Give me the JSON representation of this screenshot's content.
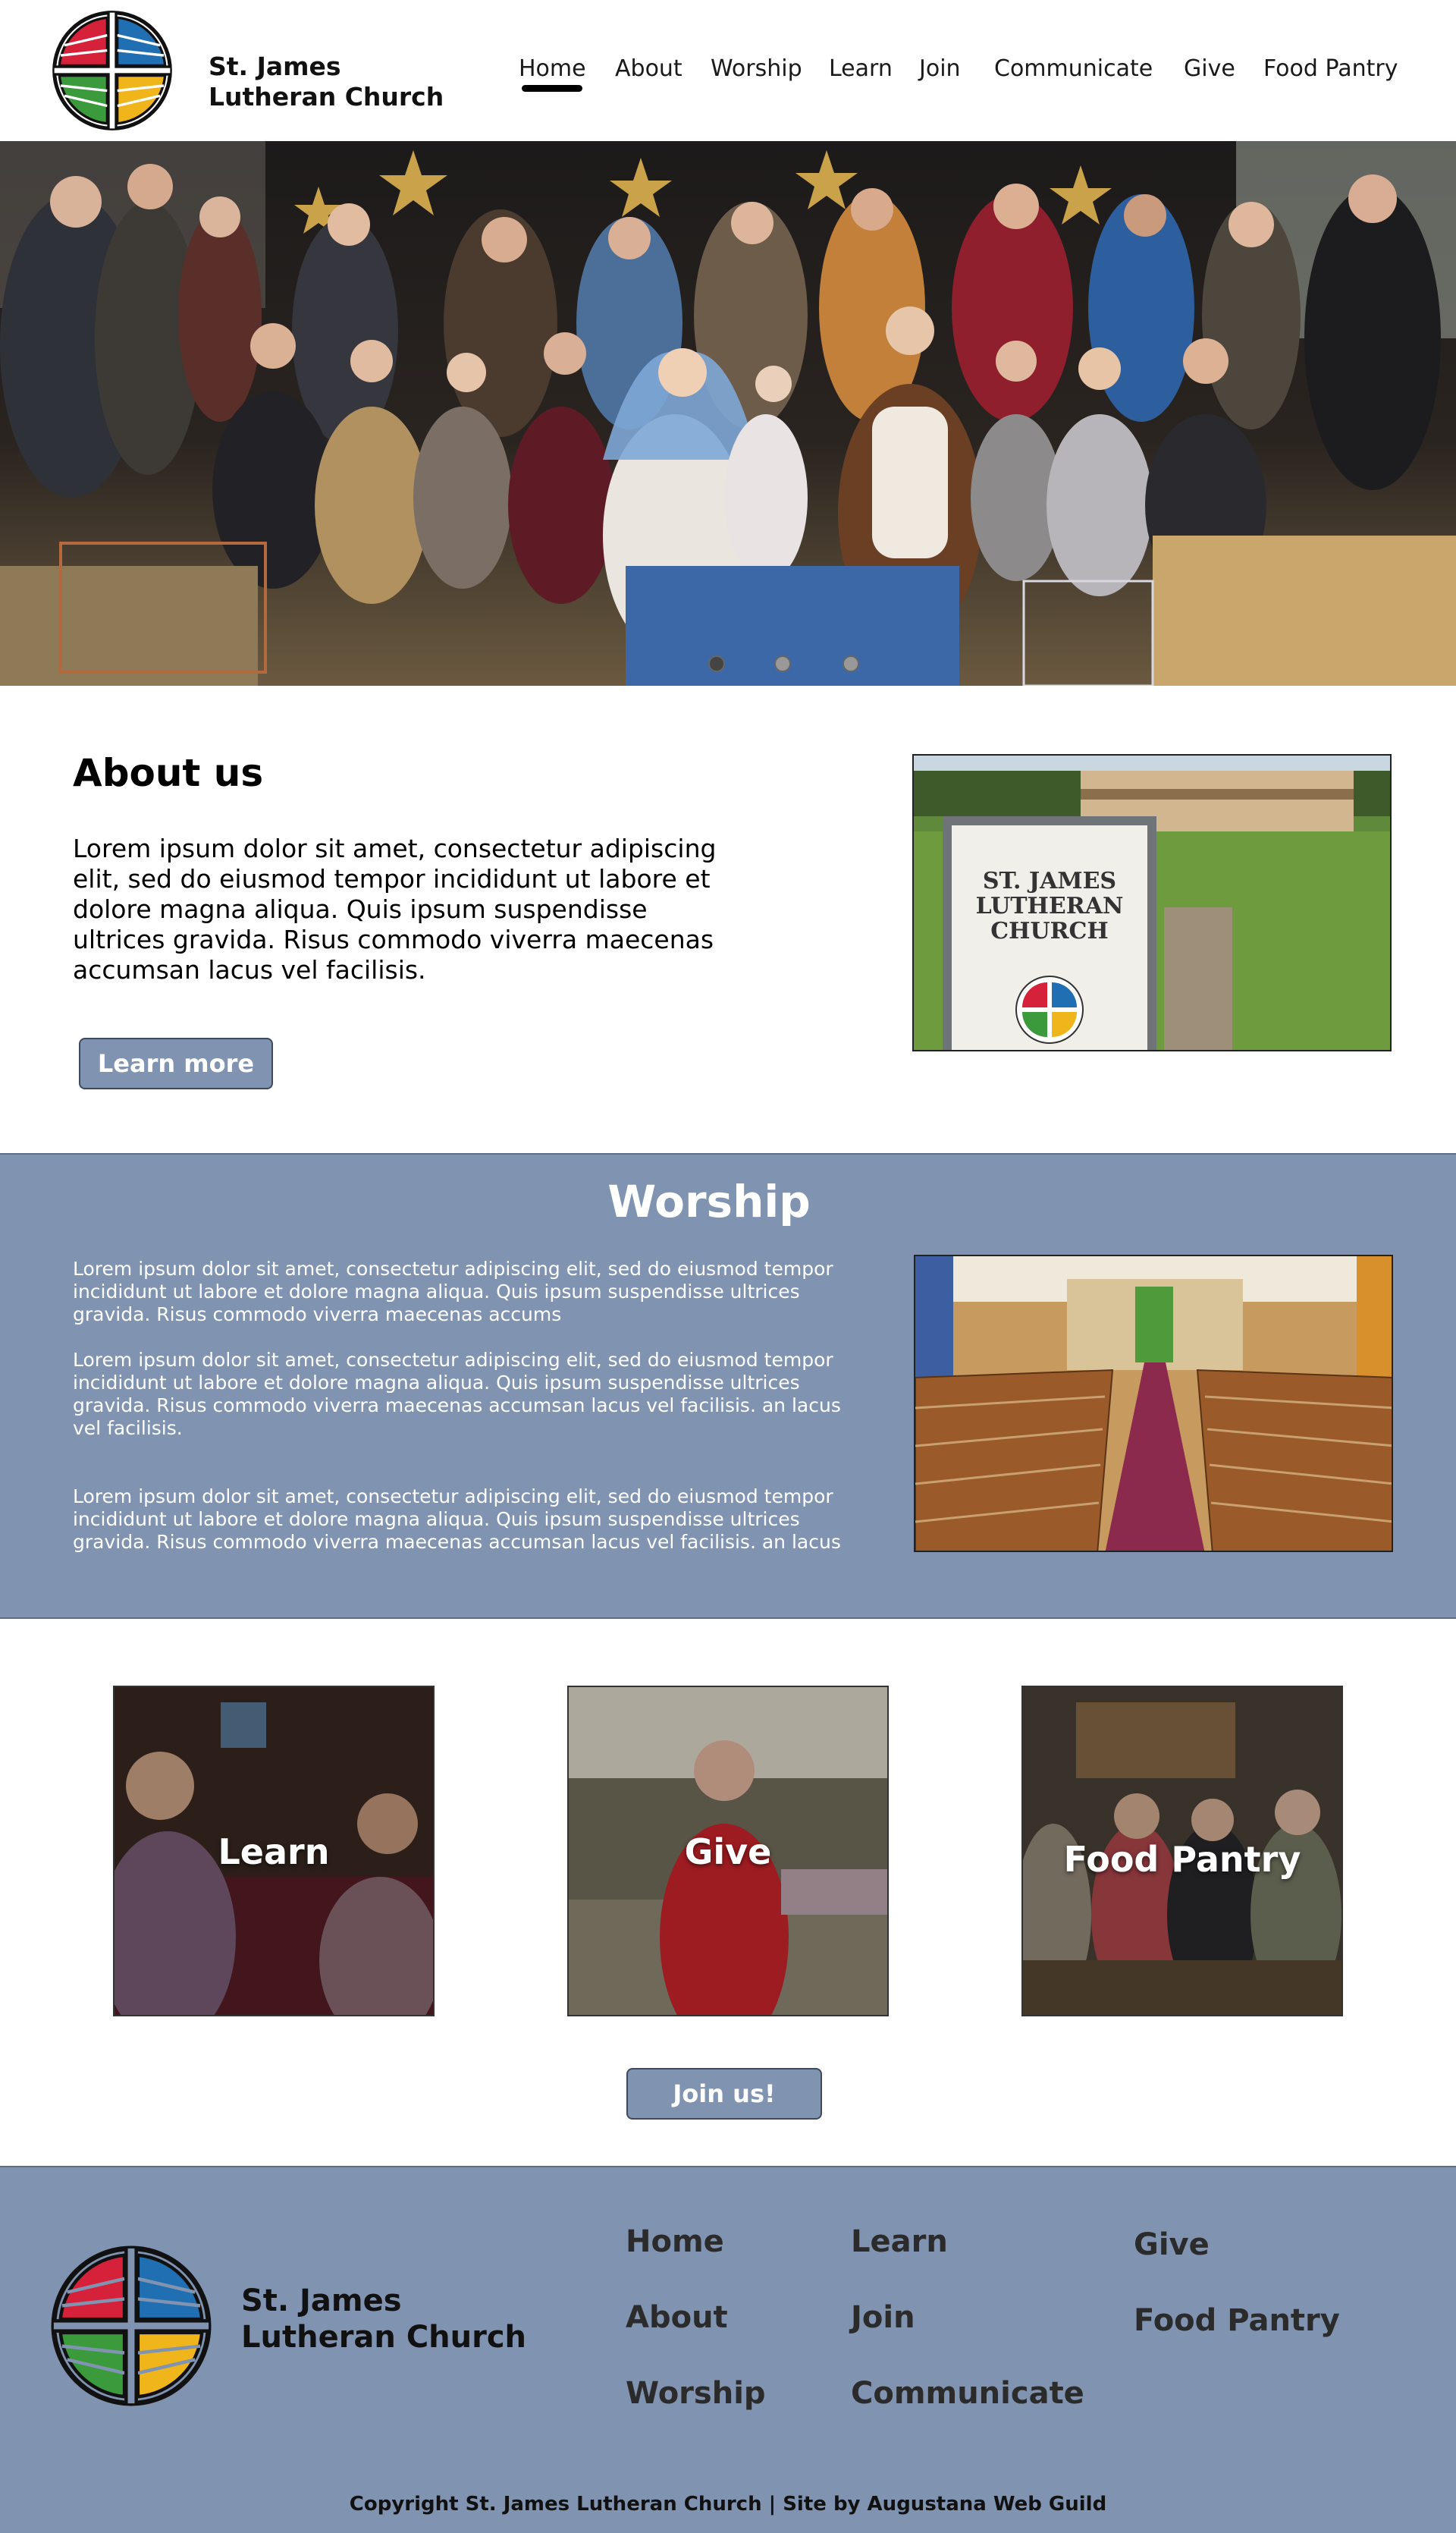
{
  "header": {
    "brand_line1": "St. James",
    "brand_line2": "Lutheran Church",
    "nav": [
      "Home",
      "About",
      "Worship",
      "Learn",
      "Join",
      "Communicate",
      "Give",
      "Food Pantry"
    ],
    "active": "Home"
  },
  "hero": {
    "slides": 3,
    "active_slide": 1
  },
  "about": {
    "title": "About us",
    "text": "Lorem ipsum dolor sit amet, consectetur adipiscing elit, sed do eiusmod tempor incididunt ut labore et dolore magna aliqua. Quis ipsum suspendisse ultrices gravida. Risus commodo viverra maecenas accumsan lacus vel facilisis.",
    "button": "Learn more",
    "sign_line1": "ST. JAMES",
    "sign_line2": "LUTHERAN",
    "sign_line3": "CHURCH"
  },
  "worship": {
    "title": "Worship",
    "p1": "Lorem ipsum dolor sit amet, consectetur adipiscing elit, sed do eiusmod tempor incididunt ut labore et dolore magna aliqua. Quis ipsum suspendisse ultrices gravida. Risus commodo viverra maecenas accums",
    "p2": "Lorem ipsum dolor sit amet, consectetur adipiscing elit, sed do eiusmod tempor incididunt ut labore et dolore magna aliqua. Quis ipsum suspendisse ultrices gravida. Risus commodo viverra maecenas accumsan lacus vel facilisis. an lacus vel facilisis.",
    "p3": "Lorem ipsum dolor sit amet, consectetur adipiscing elit, sed do eiusmod tempor incididunt ut labore et dolore magna aliqua. Quis ipsum suspendisse ultrices gravida. Risus commodo viverra maecenas accumsan lacus vel facilisis. an lacus"
  },
  "cards": [
    "Learn",
    "Give",
    "Food Pantry"
  ],
  "join_button": "Join us!",
  "footer": {
    "brand_line1": "St. James",
    "brand_line2": "Lutheran Church",
    "col1": [
      "Home",
      "About",
      "Worship"
    ],
    "col2": [
      "Learn",
      "Join",
      "Communicate"
    ],
    "col3": [
      "Give",
      "Food Pantry"
    ],
    "copyright": "Copyright St. James Lutheran Church |  Site by Augustana Web Guild"
  },
  "colors": {
    "accent": "#8093b1",
    "logo_red": "#d6213a",
    "logo_blue": "#1f6fb2",
    "logo_green": "#3a9a3c",
    "logo_yellow": "#f1b51c"
  }
}
